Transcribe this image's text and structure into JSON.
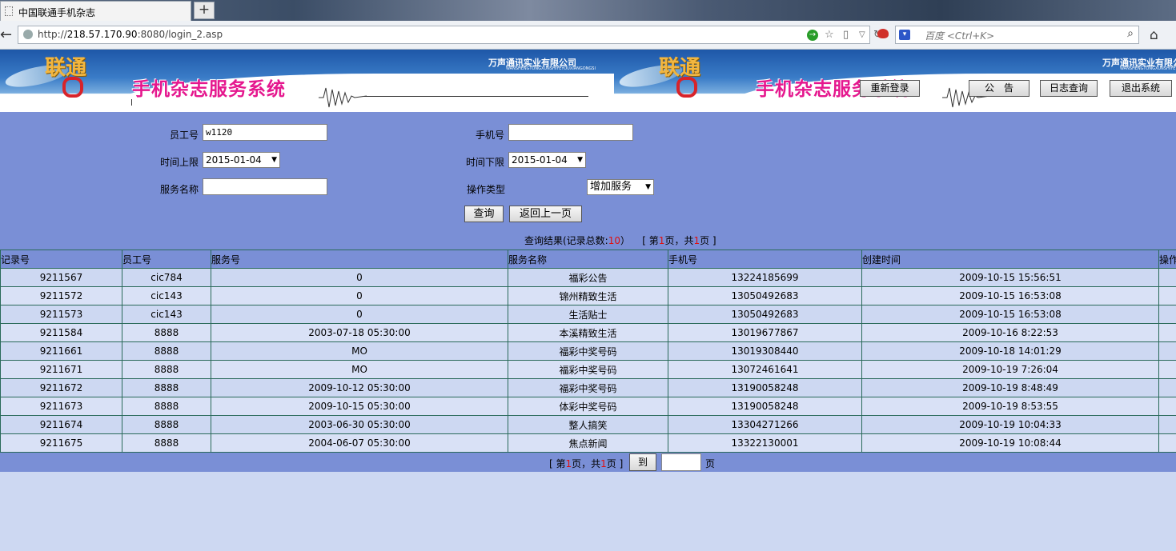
{
  "browser": {
    "tab_title": "中国联通手机杂志",
    "new_tab": "+",
    "url_prefix": "http://",
    "url_host": "218.57.170.90",
    "url_rest": ":8080/login_2.asp",
    "search_placeholder": "百度 <Ctrl+K>"
  },
  "banner": {
    "logo_text": "联通",
    "system_title": "手机杂志服务系统",
    "company": "万声通讯实业有限公司",
    "company_sub": "WANSHENGTONGXUNSHIYEYOUXIANGONGSI",
    "buttons": {
      "relogin": "重新登录",
      "notice": "公　告",
      "log_query": "日志查询",
      "exit": "退出系统"
    }
  },
  "form": {
    "employee_label": "员工号",
    "employee_value": "w1120",
    "phone_label": "手机号",
    "phone_value": "",
    "time_upper_label": "时间上限",
    "time_upper_value": "2015-01-04",
    "time_lower_label": "时间下限",
    "time_lower_value": "2015-01-04",
    "service_name_label": "服务名称",
    "service_name_value": "",
    "op_type_label": "操作类型",
    "op_type_value": "增加服务",
    "query_button": "查询",
    "back_button": "返回上一页"
  },
  "result": {
    "prefix": "查询结果(记录总数:",
    "total": "10",
    "suffix": "）",
    "page_prefix": "[ 第",
    "page_current": "1",
    "page_mid": "页，共",
    "page_total": "1",
    "page_suffix": "页 ]"
  },
  "table": {
    "headers": [
      "记录号",
      "员工号",
      "服务号",
      "服务名称",
      "手机号",
      "创建时间",
      "操作"
    ],
    "rows": [
      [
        "9211567",
        "cic784",
        "0",
        "福彩公告",
        "13224185699",
        "2009-10-15 15:56:51"
      ],
      [
        "9211572",
        "cic143",
        "0",
        "锦州精致生活",
        "13050492683",
        "2009-10-15 16:53:08"
      ],
      [
        "9211573",
        "cic143",
        "0",
        "生活贴士",
        "13050492683",
        "2009-10-15 16:53:08"
      ],
      [
        "9211584",
        "8888",
        "2003-07-18 05:30:00",
        "本溪精致生活",
        "13019677867",
        "2009-10-16 8:22:53"
      ],
      [
        "9211661",
        "8888",
        "MO",
        "福彩中奖号码",
        "13019308440",
        "2009-10-18 14:01:29"
      ],
      [
        "9211671",
        "8888",
        "MO",
        "福彩中奖号码",
        "13072461641",
        "2009-10-19 7:26:04"
      ],
      [
        "9211672",
        "8888",
        "2009-10-12 05:30:00",
        "福彩中奖号码",
        "13190058248",
        "2009-10-19 8:48:49"
      ],
      [
        "9211673",
        "8888",
        "2009-10-15 05:30:00",
        "体彩中奖号码",
        "13190058248",
        "2009-10-19 8:53:55"
      ],
      [
        "9211674",
        "8888",
        "2003-06-30 05:30:00",
        "整人搞笑",
        "13304271266",
        "2009-10-19 10:04:33"
      ],
      [
        "9211675",
        "8888",
        "2004-06-07 05:30:00",
        "焦点新闻",
        "13322130001",
        "2009-10-19 10:08:44"
      ]
    ]
  },
  "pager": {
    "prefix": "[ 第",
    "current": "1",
    "mid": "页，共",
    "total": "1",
    "suffix": "页 ]",
    "go_button": "到",
    "page_input": "",
    "unit": "页"
  },
  "colors": {
    "form_bg": "#7a8fd6",
    "page_bg": "#cdd8f2",
    "count_red": "#e01010",
    "title_magenta": "#e5178e"
  }
}
